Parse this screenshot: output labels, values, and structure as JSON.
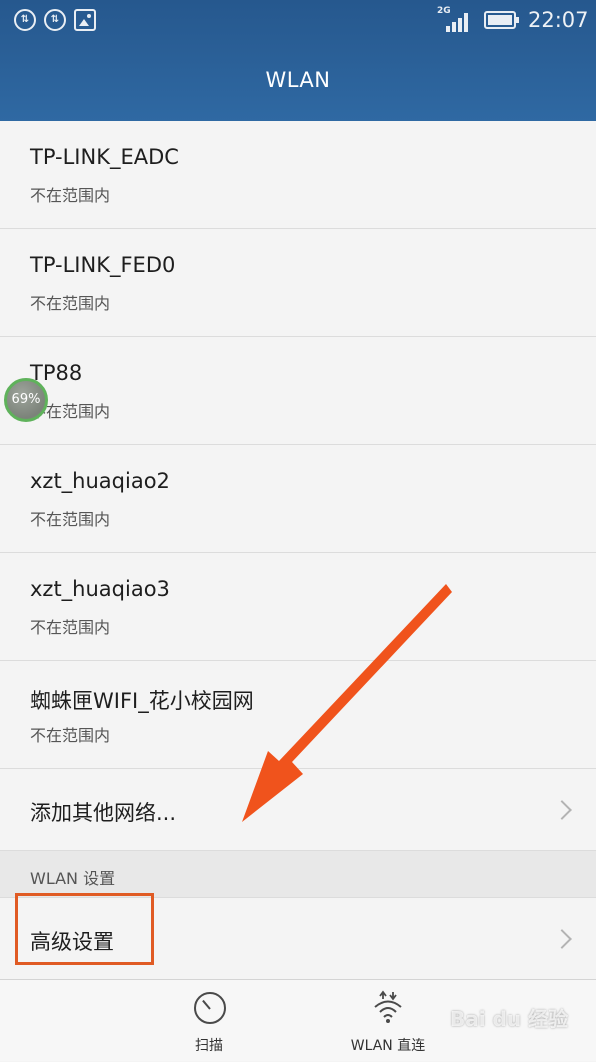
{
  "status_bar": {
    "signal_label": "2G",
    "time": "22:07"
  },
  "header": {
    "title": "WLAN"
  },
  "networks": [
    {
      "name": "TP-LINK_EADC",
      "status": "不在范围内"
    },
    {
      "name": "TP-LINK_FED0",
      "status": "不在范围内"
    },
    {
      "name": "TP88",
      "status": "不在范围内"
    },
    {
      "name": "xzt_huaqiao2",
      "status": "不在范围内"
    },
    {
      "name": "xzt_huaqiao3",
      "status": "不在范围内"
    },
    {
      "name": "蜘蛛匣WIFI_花小校园网",
      "status": "不在范围内"
    }
  ],
  "add_network": {
    "label": "添加其他网络..."
  },
  "section": {
    "label": "WLAN 设置"
  },
  "advanced": {
    "label": "高级设置"
  },
  "bottom_bar": {
    "scan_label": "扫描",
    "direct_label": "WLAN 直连"
  },
  "overlay": {
    "badge_text": "69%",
    "watermark": "Bai du 经验",
    "arrow_color": "#f0531c",
    "highlight_color": "#e05b24"
  },
  "colors": {
    "header_bg": "#2b6199",
    "list_bg": "#f4f4f4"
  }
}
